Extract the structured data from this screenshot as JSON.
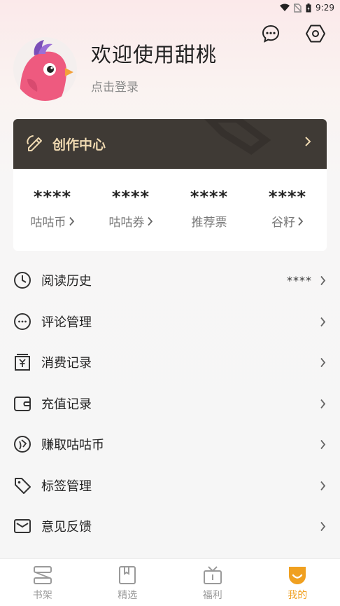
{
  "status_bar": {
    "time": "9:29"
  },
  "header": {
    "icons": [
      "chat-bubble-icon",
      "settings-hexagon-icon"
    ]
  },
  "profile": {
    "welcome": "欢迎使用甜桃",
    "login_prompt": "点击登录"
  },
  "creator_center": {
    "title": "创作中心"
  },
  "stats": [
    {
      "value": "****",
      "label": "咕咕币",
      "has_arrow": true
    },
    {
      "value": "****",
      "label": "咕咕券",
      "has_arrow": true
    },
    {
      "value": "****",
      "label": "推荐票",
      "has_arrow": false
    },
    {
      "value": "****",
      "label": "谷籽",
      "has_arrow": true
    }
  ],
  "menu": [
    {
      "label": "阅读历史",
      "extra": "****",
      "icon": "clock-icon"
    },
    {
      "label": "评论管理",
      "extra": "",
      "icon": "comment-icon"
    },
    {
      "label": "消费记录",
      "extra": "",
      "icon": "receipt-yen-icon"
    },
    {
      "label": "充值记录",
      "extra": "",
      "icon": "wallet-icon"
    },
    {
      "label": "赚取咕咕币",
      "extra": "",
      "icon": "coin-icon"
    },
    {
      "label": "标签管理",
      "extra": "",
      "icon": "tag-icon"
    },
    {
      "label": "意见反馈",
      "extra": "",
      "icon": "mail-icon"
    }
  ],
  "tabs": [
    {
      "label": "书架",
      "icon": "bookshelf-icon",
      "active": false
    },
    {
      "label": "精选",
      "icon": "book-icon",
      "active": false
    },
    {
      "label": "福利",
      "icon": "gift-icon",
      "active": false
    },
    {
      "label": "我的",
      "icon": "profile-face-icon",
      "active": true
    }
  ],
  "colors": {
    "creator_bg": "#3f3a35",
    "creator_text": "#efd9b1",
    "accent": "#f0a020"
  }
}
